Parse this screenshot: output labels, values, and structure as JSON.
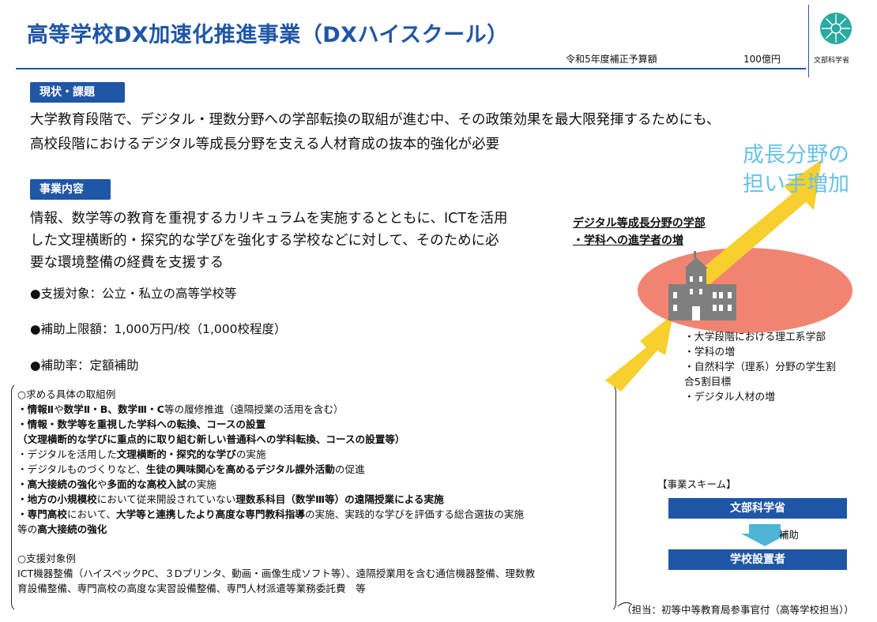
{
  "header": {
    "title": "高等学校DX加速化推進事業（DXハイスクール）",
    "budget_label": "令和5年度補正予算額",
    "budget_value": "100億円",
    "logo_text": "文部科学省"
  },
  "section1": {
    "badge": "現状・課題",
    "lines": [
      "大学教育段階で、デジタル・理数分野への学部転換の取組が進む中、その政策効果を最大限発揮するためにも、",
      "高校段階におけるデジタル等成長分野を支える人材育成の抜本的強化が必要"
    ]
  },
  "section2": {
    "badge": "事業内容",
    "lines": [
      "情報、数学等の教育を重視するカリキュラムを実施するとともに、ICTを活用",
      "した文理横断的・探究的な学びを強化する学校などに対して、そのために必",
      "要な環境整備の経費を支援する"
    ],
    "items": [
      "●支援対象：公立・私立の高等学校等",
      "●補助上限額：1,000万円/校（1,000校程度）",
      "●補助率：定額補助"
    ]
  },
  "box": {
    "examples_title": "○求める具体の取組例",
    "l1_b1": "・情報Ⅱ",
    "l1_t1": "や",
    "l1_b2": "数学Ⅱ・B、数学Ⅲ・C",
    "l1_t2": "等の履修推進（遠隔授業の活用を含む）",
    "l2": "・情報・数学等を重視した学科への転換、コースの設置",
    "l3": "（文理横断的な学びに重点的に取り組む新しい普通科への学科転換、コースの設置等）",
    "l4_t1": "・デジタルを活用した",
    "l4_b1": "文理横断的・探究的な学び",
    "l4_t2": "の実施",
    "l5_t1": "・デジタルものづくりなど、",
    "l5_b1": "生徒の興味関心を高めるデジタル課外活動",
    "l5_t2": "の促進",
    "l6_b1": "・高大接続の強化",
    "l6_t1": "や",
    "l6_b2": "多面的な高校入試",
    "l6_t2": "の実施",
    "l7_b1": "・地方の小規模校",
    "l7_t1": "において従来開設されていない",
    "l7_b2": "理数系科目（数学Ⅲ等）の遠隔授業による実施",
    "l8_b1": "・専門高校",
    "l8_t1": "において、",
    "l8_b2": "大学等と連携したより高度な専門教科指導",
    "l8_t2": "の実施、実践的な学びを評価する総合選抜の実施",
    "l9_t1": "等の",
    "l9_b1": "高大接続の強化",
    "support_title": "○支援対象例",
    "s1": "ICT機器整備（ハイスペックPC、３Dプリンタ、動画・画像生成ソフト等）、遠隔授業用を含む通信機器整備、理数教",
    "s2": "育設備整備、専門高校の高度な実習設備整備、専門人材派遣等業務委託費　等"
  },
  "diagram": {
    "growth_line1": "成長分野の",
    "growth_line2": "担い手増加",
    "flow_line1": "デジタル等成長分野の学部",
    "flow_line2": "・学科への進学者の増",
    "univ_items": [
      "・大学段階における理工系学部",
      "・学科の増",
      "・自然科学（理系）分野の学生割",
      "合5割目標",
      "・デジタル人材の増"
    ],
    "building_icon": "school-building-icon"
  },
  "scheme": {
    "title": "【事業スキーム】",
    "top": "文部科学省",
    "arrow_label": "補助",
    "bottom": "学校設置者"
  },
  "footer": "（担当：初等中等教育局参事官付（高等学校担当））",
  "colors": {
    "brand_blue": "#1f56a6",
    "arrow_yellow": "#f7cf2e",
    "ellipse_red": "#ef6f57",
    "growth_text": "#66c2e8",
    "scheme_arrow": "#4fb4d8"
  }
}
